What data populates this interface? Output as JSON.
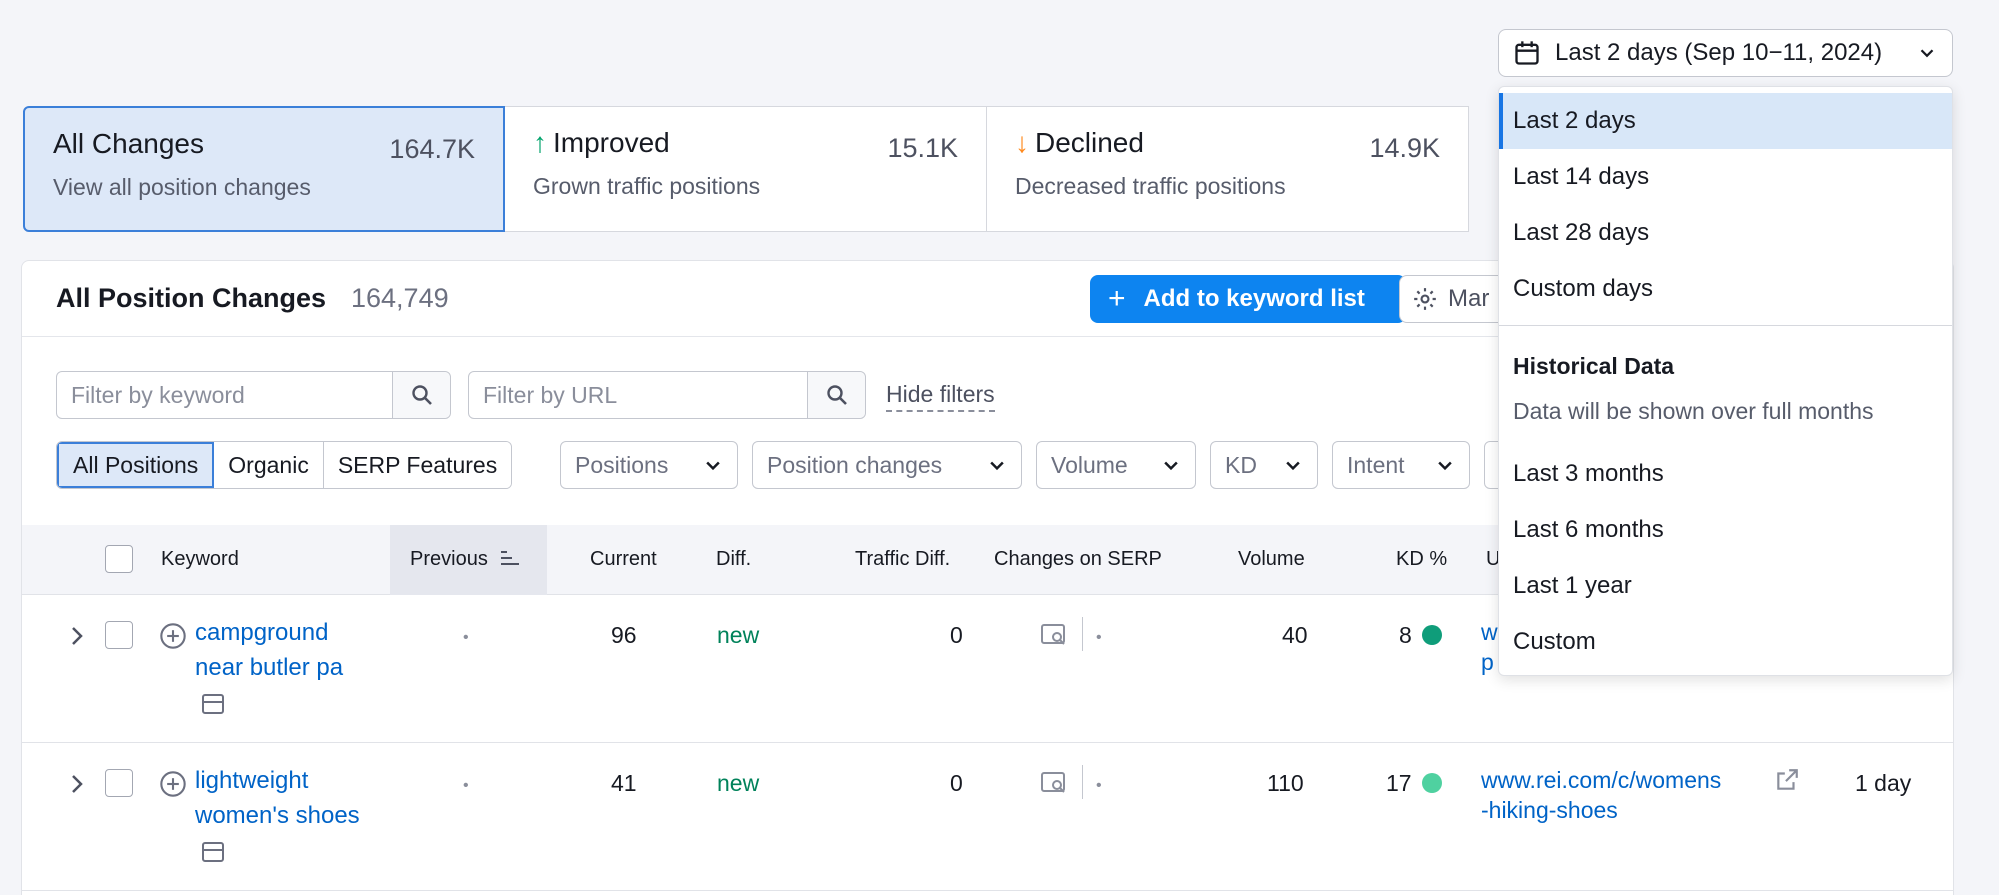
{
  "date_picker": {
    "label": "Last 2 days (Sep 10−11, 2024)"
  },
  "cards": [
    {
      "title": "All Changes",
      "count": "164.7K",
      "subtitle": "View all position changes"
    },
    {
      "title": "Improved",
      "count": "15.1K",
      "subtitle": "Grown traffic positions",
      "arrow": "↑",
      "arrow_color": "#00a36b"
    },
    {
      "title": "Declined",
      "count": "14.9K",
      "subtitle": "Decreased traffic positions",
      "arrow": "↓",
      "arrow_color": "#ff8a1f"
    }
  ],
  "panel": {
    "title": "All Position Changes",
    "count": "164,749",
    "add_button": "Add to keyword list",
    "manage_button": "Mar"
  },
  "filters": {
    "keyword_placeholder": "Filter by keyword",
    "url_placeholder": "Filter by URL",
    "hide_filters": "Hide filters",
    "segments": [
      "All Positions",
      "Organic",
      "SERP Features"
    ],
    "dropdowns": [
      "Positions",
      "Position changes",
      "Volume",
      "KD",
      "Intent"
    ]
  },
  "table": {
    "headers": {
      "keyword": "Keyword",
      "previous": "Previous",
      "current": "Current",
      "diff": "Diff.",
      "traffic_diff": "Traffic Diff.",
      "changes_on_serp": "Changes on SERP",
      "volume": "Volume",
      "kd": "KD %",
      "url": "U"
    },
    "rows": [
      {
        "keyword": "campground near butler pa",
        "previous": "•",
        "current": "96",
        "diff": "new",
        "traffic_diff": "0",
        "serp_dot": "•",
        "volume": "40",
        "kd": "8",
        "kd_color": "#0f9d7a",
        "url_line1": "w",
        "url_line2": "p",
        "updated": ""
      },
      {
        "keyword": "lightweight women's shoes",
        "previous": "•",
        "current": "41",
        "diff": "new",
        "traffic_diff": "0",
        "serp_dot": "•",
        "volume": "110",
        "kd": "17",
        "kd_color": "#4fd1a0",
        "url_line1": "www.rei.com/c/womens",
        "url_line2": "-hiking-shoes",
        "updated": "1 day"
      }
    ]
  },
  "menu": {
    "items": [
      "Last 2 days",
      "Last 14 days",
      "Last 28 days",
      "Custom days"
    ],
    "historical_heading": "Historical Data",
    "historical_desc": "Data will be shown over full months",
    "historical_items": [
      "Last 3 months",
      "Last 6 months",
      "Last 1 year",
      "Custom"
    ]
  }
}
